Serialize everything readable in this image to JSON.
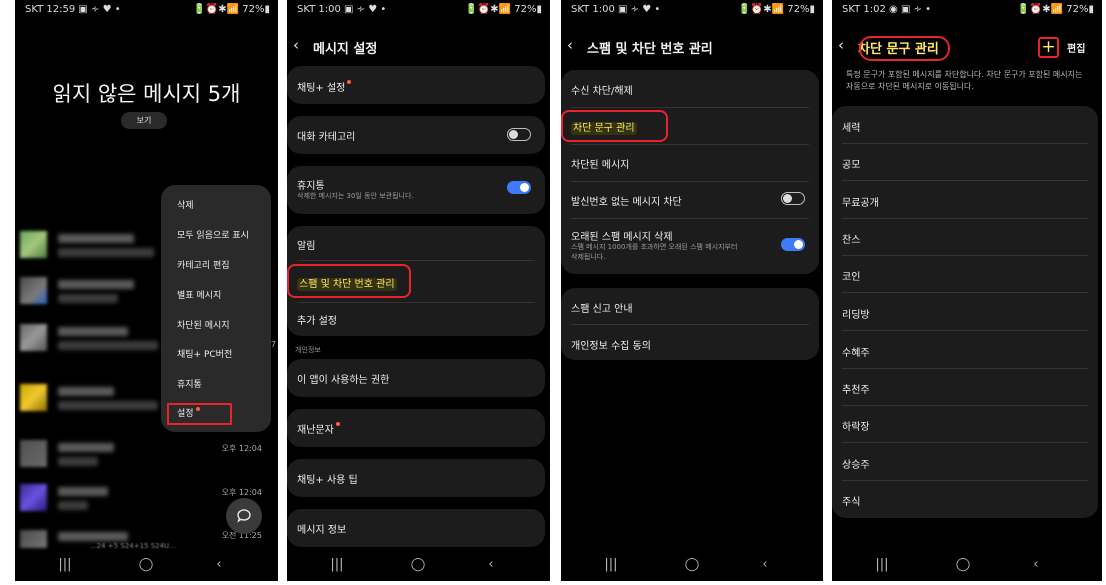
{
  "common": {
    "nav_recent": "|||",
    "nav_home": "◯",
    "nav_back": "‹",
    "back_arrow": "‹",
    "status_right": "🔋⏰✱📶 72%▮"
  },
  "phone1": {
    "status_left": "SKT 12:59 ▣ ∻ ♥ •",
    "unread_title": "읽지 않은 메시지 5개",
    "view_button": "보기",
    "times": [
      "7",
      "",
      "",
      "오후 12:04",
      "오후 12:04",
      "오전 11:25"
    ],
    "bottom_snippet": "...24 +5 S24+15 S24U...",
    "menu": [
      "삭제",
      "모두 읽음으로 표시",
      "카테고리 편집",
      "별표 메시지",
      "차단된 메시지",
      "채팅+ PC버전",
      "휴지통",
      "설정"
    ],
    "fab_icon": "chat-plus"
  },
  "phone2": {
    "status_left": "SKT 1:00 ▣ ∻ ♥ •",
    "title": "메시지 설정",
    "chat_plus_settings": "채팅+ 설정",
    "conversation_category": "대화 카테고리",
    "trash": "휴지통",
    "trash_desc": "삭제한 메시지는 30일 동안 보관됩니다.",
    "notifications": "알림",
    "spam_block": "스팸 및 차단 번호 관리",
    "more_settings": "추가 설정",
    "privacy_header": "개인정보",
    "permissions": "이 앱이 사용하는 권한",
    "emergency": "재난문자",
    "tips": "채팅+ 사용 팁",
    "about": "메시지 정보",
    "category_toggle_on": false,
    "trash_toggle_on": true
  },
  "phone3": {
    "status_left": "SKT 1:00 ▣ ∻ ♥ •",
    "title": "스팸 및 차단 번호 관리",
    "block_unblock": "수신 차단/해제",
    "block_phrases": "차단 문구 관리",
    "blocked_messages": "차단된 메시지",
    "block_no_caller": "발신번호 없는 메시지 차단",
    "delete_old_spam": "오래된 스팸 메시지 삭제",
    "delete_old_spam_desc": [
      "스팸 메시지 1000개를 초과하면 오래된 스팸 메시지부터",
      "삭제됩니다."
    ],
    "spam_report": "스팸 신고 안내",
    "privacy_consent": "개인정보 수집 동의",
    "no_caller_toggle_on": false,
    "delete_old_toggle_on": true
  },
  "phone4": {
    "status_left": "SKT 1:02 ◉ ▣ ∻ •",
    "title": "차단 문구 관리",
    "plus": "+",
    "edit": "편집",
    "description": "특정 문구가 포함된 메시지를 차단합니다. 차단 문구가 포함된 메시지는 자동으로 차단된 메시지로 이동됩니다.",
    "phrases": [
      "세력",
      "공모",
      "무료공개",
      "찬스",
      "코인",
      "리딩방",
      "수혜주",
      "추천주",
      "하락장",
      "상승주",
      "주식"
    ]
  },
  "colors": {
    "highlight_text": "#ffe86b",
    "annotation_red": "#e8232c",
    "toggle_on": "#3e7bfa",
    "notification_dot": "#ff5a3c"
  }
}
